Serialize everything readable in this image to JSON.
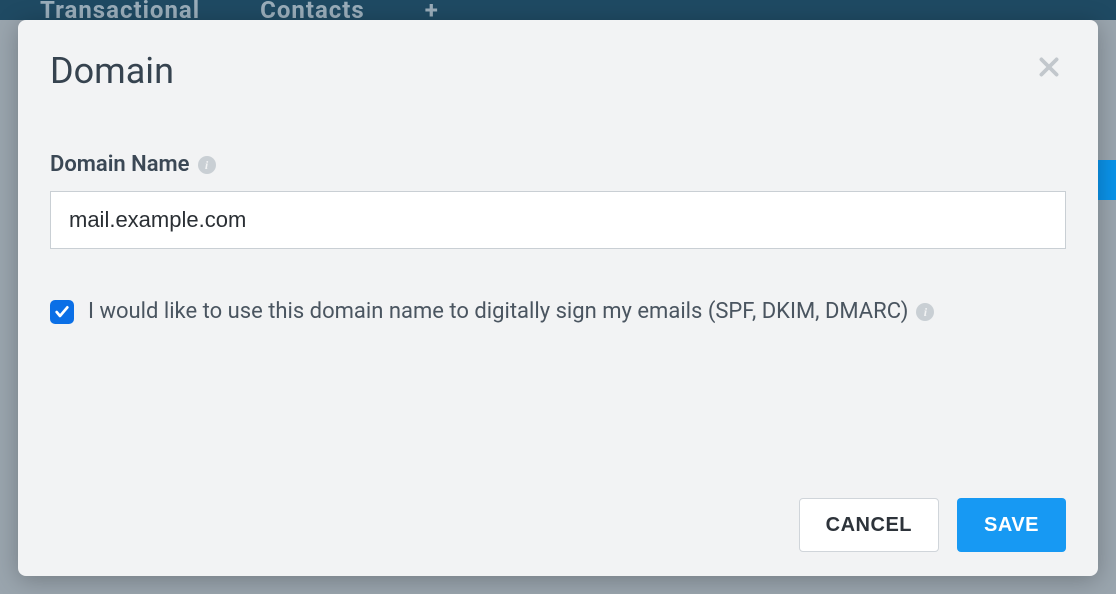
{
  "background": {
    "nav_items": [
      "Transactional",
      "Contacts",
      "+"
    ]
  },
  "modal": {
    "title": "Domain",
    "field": {
      "label": "Domain Name",
      "value": "mail.example.com"
    },
    "checkbox": {
      "checked": true,
      "label": "I would like to use this domain name to digitally sign my emails (SPF, DKIM, DMARC)"
    },
    "buttons": {
      "cancel": "CANCEL",
      "save": "SAVE"
    }
  }
}
